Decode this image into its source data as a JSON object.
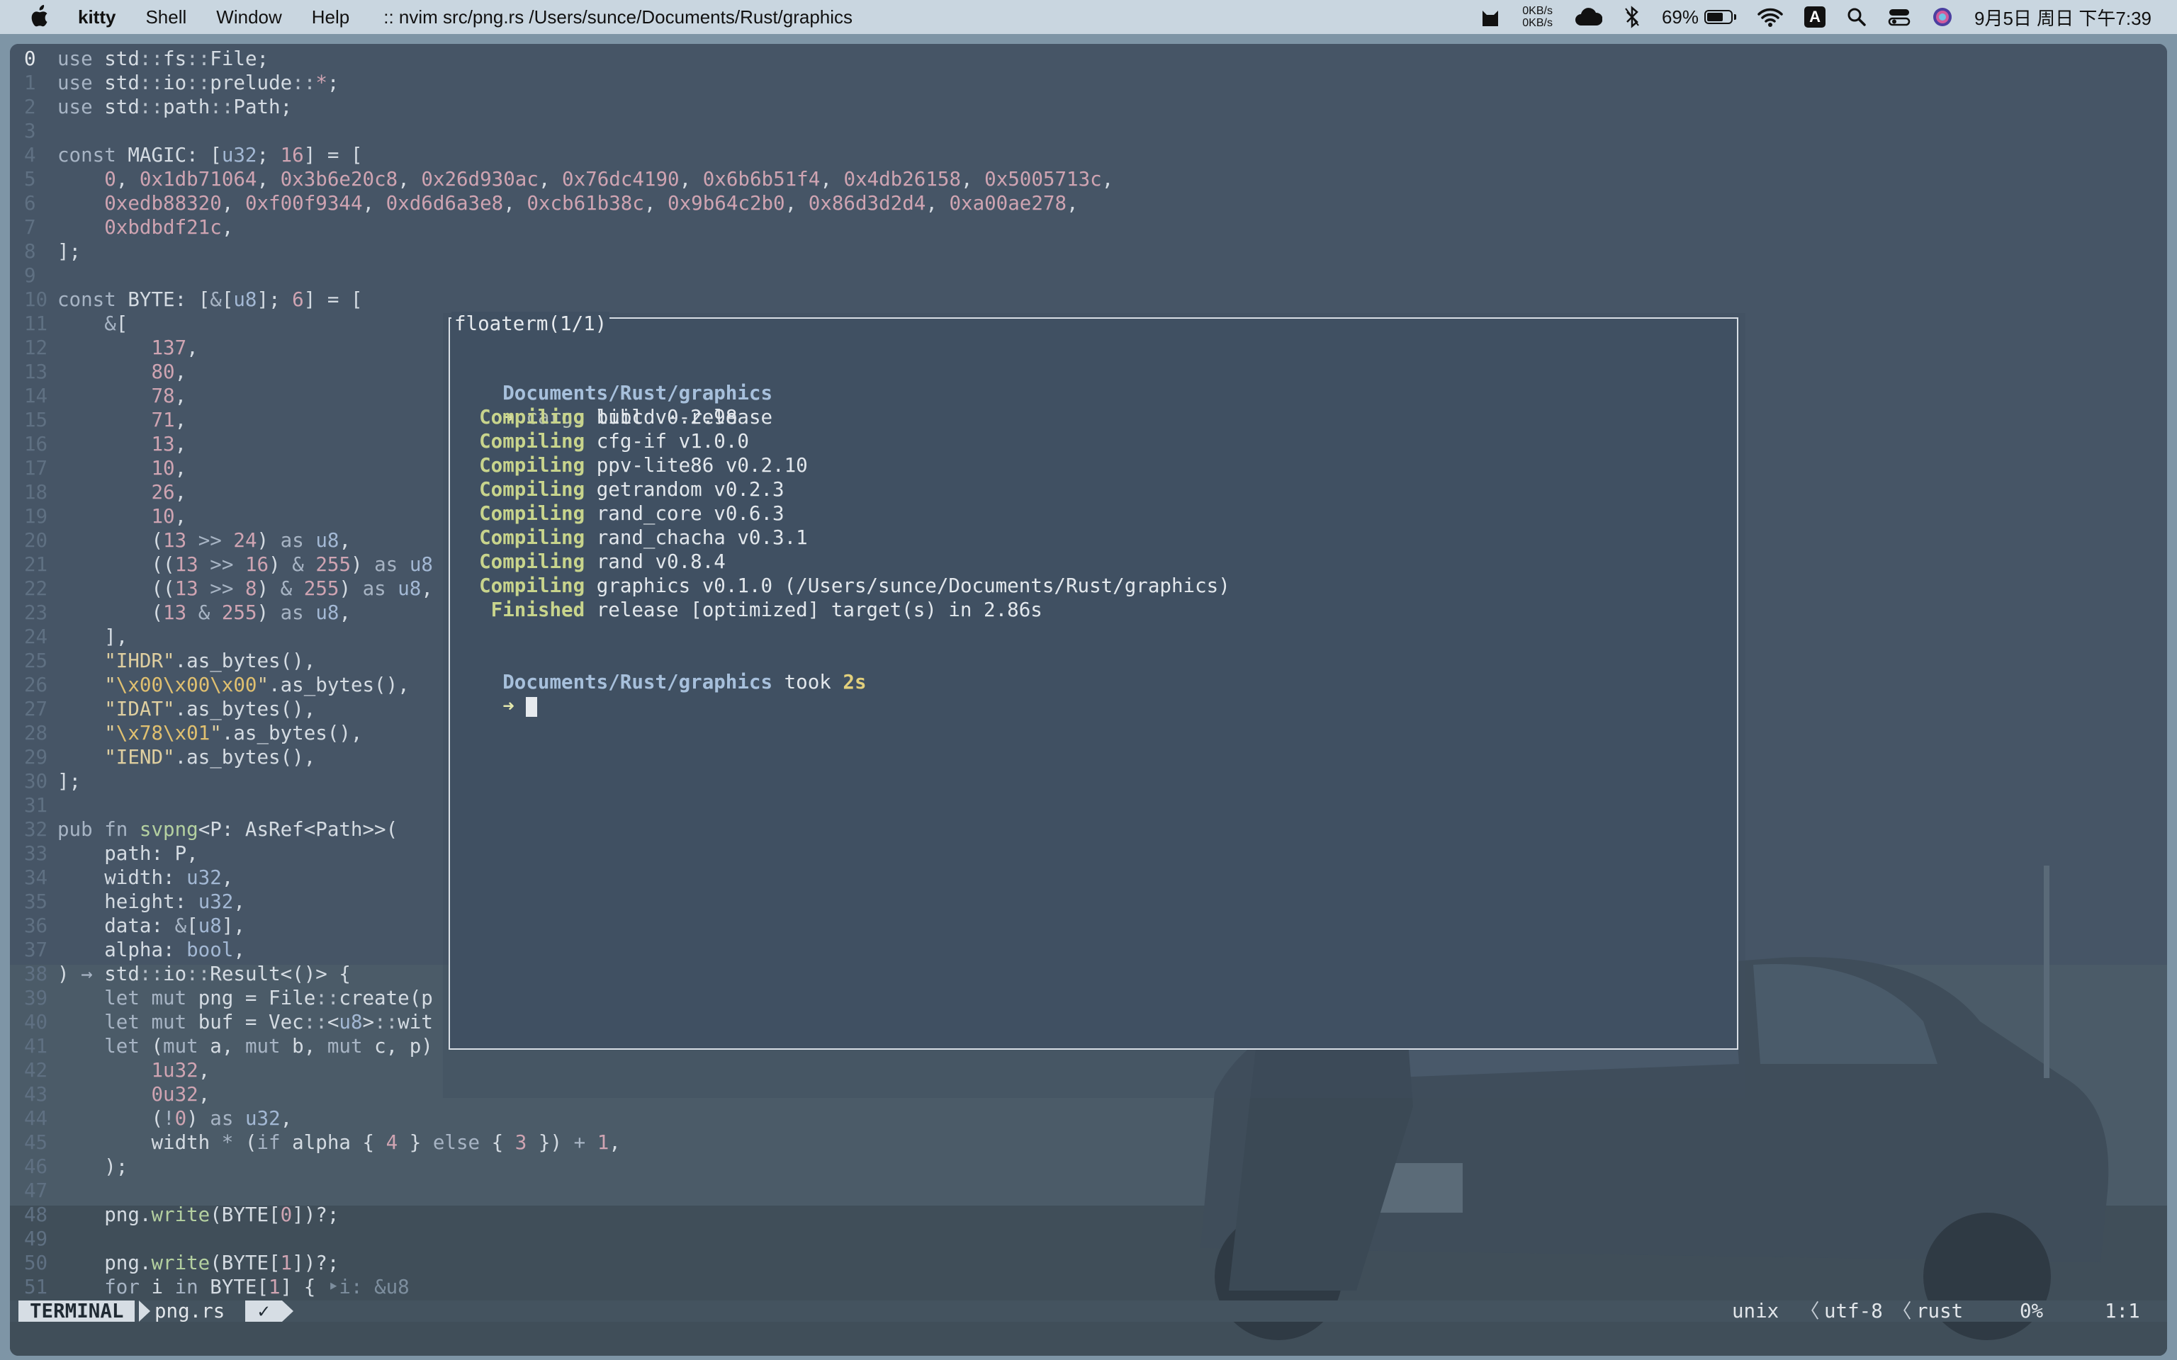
{
  "menubar": {
    "app_name": "kitty",
    "menus": [
      "Shell",
      "Window",
      "Help"
    ],
    "window_title": ":: nvim src/png.rs /Users/sunce/Documents/Rust/graphics",
    "net_up": "0KB/s",
    "net_down": "0KB/s",
    "battery_percent": "69%",
    "battery_level": 0.69,
    "input_method": "A",
    "clock": "9月5日 周日 下午7:39"
  },
  "editor": {
    "lines": [
      {
        "n": "0",
        "h": "<span class=\"k\">use</span> std<span class=\"p\">::</span>fs<span class=\"p\">::</span>File;"
      },
      {
        "n": "1",
        "h": "<span class=\"k\">use</span> std<span class=\"p\">::</span>io<span class=\"p\">::</span>prelude<span class=\"p\">::</span><span class=\"n\">*</span>;"
      },
      {
        "n": "2",
        "h": "<span class=\"k\">use</span> std<span class=\"p\">::</span>path<span class=\"p\">::</span>Path;"
      },
      {
        "n": "3",
        "h": ""
      },
      {
        "n": "4",
        "h": "<span class=\"k\">const</span> MAGIC: [<span class=\"t\">u32</span>; <span class=\"n\">16</span>] = ["
      },
      {
        "n": "5",
        "h": "    <span class=\"n\">0</span>, <span class=\"n\">0x1db71064</span>, <span class=\"n\">0x3b6e20c8</span>, <span class=\"n\">0x26d930ac</span>, <span class=\"n\">0x76dc4190</span>, <span class=\"n\">0x6b6b51f4</span>, <span class=\"n\">0x4db26158</span>, <span class=\"n\">0x5005713c</span>,"
      },
      {
        "n": "6",
        "h": "    <span class=\"n\">0xedb88320</span>, <span class=\"n\">0xf00f9344</span>, <span class=\"n\">0xd6d6a3e8</span>, <span class=\"n\">0xcb61b38c</span>, <span class=\"n\">0x9b64c2b0</span>, <span class=\"n\">0x86d3d2d4</span>, <span class=\"n\">0xa00ae278</span>,"
      },
      {
        "n": "7",
        "h": "    <span class=\"n\">0xbdbdf21c</span>,"
      },
      {
        "n": "8",
        "h": "];"
      },
      {
        "n": "9",
        "h": ""
      },
      {
        "n": "10",
        "h": "<span class=\"k\">const</span> BYTE: [<span class=\"k\">&amp;</span>[<span class=\"t\">u8</span>]; <span class=\"n\">6</span>] = ["
      },
      {
        "n": "11",
        "h": "    <span class=\"k\">&amp;</span>["
      },
      {
        "n": "12",
        "h": "        <span class=\"n\">137</span>,"
      },
      {
        "n": "13",
        "h": "        <span class=\"n\">80</span>,"
      },
      {
        "n": "14",
        "h": "        <span class=\"n\">78</span>,"
      },
      {
        "n": "15",
        "h": "        <span class=\"n\">71</span>,"
      },
      {
        "n": "16",
        "h": "        <span class=\"n\">13</span>,"
      },
      {
        "n": "17",
        "h": "        <span class=\"n\">10</span>,"
      },
      {
        "n": "18",
        "h": "        <span class=\"n\">26</span>,"
      },
      {
        "n": "19",
        "h": "        <span class=\"n\">10</span>,"
      },
      {
        "n": "20",
        "h": "        (<span class=\"n\">13</span> <span class=\"k\">&gt;&gt;</span> <span class=\"n\">24</span>) <span class=\"k\">as</span> <span class=\"t\">u8</span>,"
      },
      {
        "n": "21",
        "h": "        ((<span class=\"n\">13</span> <span class=\"k\">&gt;&gt;</span> <span class=\"n\">16</span>) <span class=\"k\">&amp;</span> <span class=\"n\">255</span>) <span class=\"k\">as</span> <span class=\"t\">u8</span>"
      },
      {
        "n": "22",
        "h": "        ((<span class=\"n\">13</span> <span class=\"k\">&gt;&gt;</span> <span class=\"n\">8</span>) <span class=\"k\">&amp;</span> <span class=\"n\">255</span>) <span class=\"k\">as</span> <span class=\"t\">u8</span>,"
      },
      {
        "n": "23",
        "h": "        (<span class=\"n\">13</span> <span class=\"k\">&amp;</span> <span class=\"n\">255</span>) <span class=\"k\">as</span> <span class=\"t\">u8</span>,"
      },
      {
        "n": "24",
        "h": "    ],"
      },
      {
        "n": "25",
        "h": "    <span class=\"s\">\"IHDR\"</span>.as_bytes(),"
      },
      {
        "n": "26",
        "h": "    <span class=\"s\">\"</span><span class=\"e\">\\x00\\x00\\x00</span><span class=\"s\">\"</span>.as_bytes(),"
      },
      {
        "n": "27",
        "h": "    <span class=\"s\">\"IDAT\"</span>.as_bytes(),"
      },
      {
        "n": "28",
        "h": "    <span class=\"s\">\"</span><span class=\"e\">\\x78\\x01</span><span class=\"s\">\"</span>.as_bytes(),"
      },
      {
        "n": "29",
        "h": "    <span class=\"s\">\"IEND\"</span>.as_bytes(),"
      },
      {
        "n": "30",
        "h": "];"
      },
      {
        "n": "31",
        "h": ""
      },
      {
        "n": "32",
        "h": "<span class=\"k\">pub fn</span> <span class=\"f\">svpng</span>&lt;P: AsRef&lt;Path&gt;&gt;("
      },
      {
        "n": "33",
        "h": "    path: P,"
      },
      {
        "n": "34",
        "h": "    width: <span class=\"t\">u32</span>,"
      },
      {
        "n": "35",
        "h": "    height: <span class=\"t\">u32</span>,"
      },
      {
        "n": "36",
        "h": "    data: <span class=\"k\">&amp;</span>[<span class=\"t\">u8</span>],"
      },
      {
        "n": "37",
        "h": "    alpha: <span class=\"t\">bool</span>,"
      },
      {
        "n": "38",
        "h": ") <span class=\"k\">→</span> std<span class=\"p\">::</span>io<span class=\"p\">::</span>Result&lt;()&gt; {"
      },
      {
        "n": "39",
        "h": "    <span class=\"k\">let mut</span> png = File<span class=\"p\">::</span>create(p"
      },
      {
        "n": "40",
        "h": "    <span class=\"k\">let mut</span> buf = Vec<span class=\"p\">::</span>&lt;<span class=\"t\">u8</span>&gt;<span class=\"p\">::</span>wit"
      },
      {
        "n": "41",
        "h": "    <span class=\"k\">let</span> (<span class=\"k\">mut</span> a, <span class=\"k\">mut</span> b, <span class=\"k\">mut</span> c, p)"
      },
      {
        "n": "42",
        "h": "        <span class=\"n\">1u32</span>,"
      },
      {
        "n": "43",
        "h": "        <span class=\"n\">0u32</span>,"
      },
      {
        "n": "44",
        "h": "        (<span class=\"k\">!</span><span class=\"n\">0</span>) <span class=\"k\">as</span> <span class=\"t\">u32</span>,"
      },
      {
        "n": "45",
        "h": "        width <span class=\"k\">*</span> (<span class=\"k\">if</span> alpha { <span class=\"n\">4</span> } <span class=\"k\">else</span> { <span class=\"n\">3</span> }) <span class=\"k\">+</span> <span class=\"n\">1</span>,"
      },
      {
        "n": "46",
        "h": "    );"
      },
      {
        "n": "47",
        "h": ""
      },
      {
        "n": "48",
        "h": "    png.<span class=\"f\">write</span>(BYTE[<span class=\"n\">0</span>])?;"
      },
      {
        "n": "49",
        "h": ""
      },
      {
        "n": "50",
        "h": "    png.<span class=\"f\">write</span>(BYTE[<span class=\"n\">1</span>])?;"
      },
      {
        "n": "51",
        "h": "    <span class=\"k\">for</span> i <span class=\"k\">in</span> BYTE[<span class=\"n\">1</span>] { <span class=\"h\">‣i: &amp;u8</span>"
      }
    ]
  },
  "floaterm": {
    "title": "floaterm(1/1)",
    "prompt_path_1": "Documents/Rust/graphics",
    "arrow": "➜",
    "cmd_program": "cargo",
    "cmd_args": " build --release",
    "compile_label": "Compiling",
    "compile_items": [
      "libc v0.2.98",
      "cfg-if v1.0.0",
      "ppv-lite86 v0.2.10",
      "getrandom v0.2.3",
      "rand_core v0.6.3",
      "rand_chacha v0.3.1",
      "rand v0.8.4",
      "graphics v0.1.0 (/Users/sunce/Documents/Rust/graphics)"
    ],
    "finished_label": "Finished",
    "finished_text": "release [optimized] target(s) in 2.86s",
    "prompt_path_2": "Documents/Rust/graphics",
    "took_label": " took ",
    "took_value": "2s"
  },
  "statusline": {
    "mode": "TERMINAL",
    "filename": "png.rs",
    "check": "✓",
    "fileformat": "unix",
    "encoding": "utf-8",
    "filetype": "rust",
    "percent": "0%",
    "position": "1:1"
  },
  "colors": {
    "menubar_bg": "#c9d6e0",
    "terminal_bg": "#465566",
    "popup_border": "#d9dfe6",
    "prompt_path": "#a7c0dc",
    "compiling_green": "#c8d48c"
  }
}
